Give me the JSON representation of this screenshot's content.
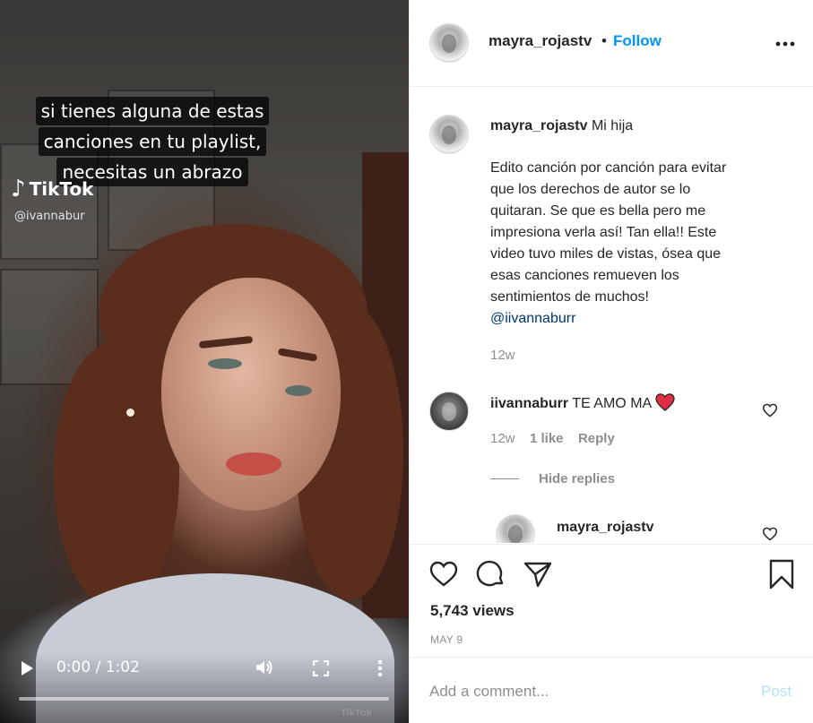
{
  "video": {
    "caption_lines": [
      "si tienes alguna de estas",
      "canciones en tu playlist,",
      "necesitas un abrazo"
    ],
    "tiktok_logo": "TikTok",
    "tiktok_handle": "@ivannabur",
    "time": "0:00 / 1:02",
    "watermark": "TikTok",
    "progress": 0.0
  },
  "header": {
    "username": "mayra_rojastv",
    "separator": "•",
    "follow_label": "Follow"
  },
  "caption_comment": {
    "username": "mayra_rojastv",
    "title": "Mi hija",
    "body_lines": [
      "Edito canción por canción para evitar",
      "que los derechos de autor se lo",
      "quitaran. Se que es bella pero me",
      "impresiona verla así! Tan ella!! Este",
      "video tuvo miles de vistas, ósea que",
      "esas canciones remueven los",
      "sentimientos de muchos!"
    ],
    "mention": "@iivannaburr",
    "age": "12w"
  },
  "comment": {
    "username": "iivannaburr",
    "text": "TE AMO MA",
    "emoji": "❤️",
    "age": "12w",
    "likes": "1 like",
    "reply_label": "Reply",
    "hide_replies_label": "Hide replies"
  },
  "reply": {
    "username": "mayra_rojastv"
  },
  "actions": {
    "icons": [
      "heart-icon",
      "comment-icon",
      "share-icon",
      "bookmark-icon"
    ],
    "views": "5,743 views",
    "date": "MAY 9"
  },
  "composer": {
    "placeholder": "Add a comment...",
    "post_label": "Post"
  },
  "colors": {
    "follow_blue": "#0095f6",
    "post_disabled": "#b2dffc",
    "heart_red": "#ed4956",
    "secondary_text": "#8e8e8e"
  }
}
